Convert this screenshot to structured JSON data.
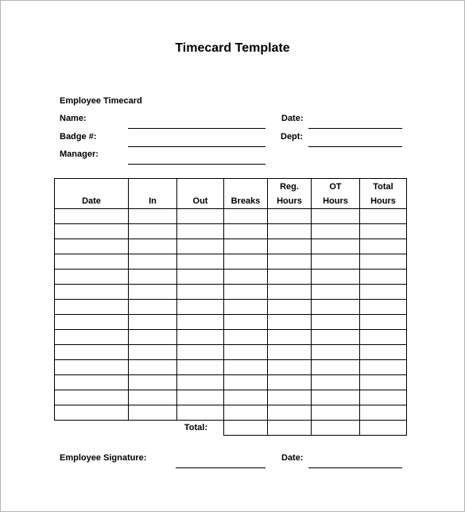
{
  "title": "Timecard Template",
  "section": "Employee Timecard",
  "fields": {
    "name": "Name:",
    "badge": "Badge #:",
    "manager": "Manager:",
    "date": "Date:",
    "dept": "Dept:"
  },
  "table": {
    "headers": [
      {
        "line1": "",
        "line2": "Date"
      },
      {
        "line1": "",
        "line2": "In"
      },
      {
        "line1": "",
        "line2": "Out"
      },
      {
        "line1": "",
        "line2": "Breaks"
      },
      {
        "line1": "Reg.",
        "line2": "Hours"
      },
      {
        "line1": "OT",
        "line2": "Hours"
      },
      {
        "line1": "Total",
        "line2": "Hours"
      }
    ],
    "row_count": 14,
    "total_label": "Total:"
  },
  "footer": {
    "signature": "Employee Signature:",
    "date": "Date:"
  }
}
